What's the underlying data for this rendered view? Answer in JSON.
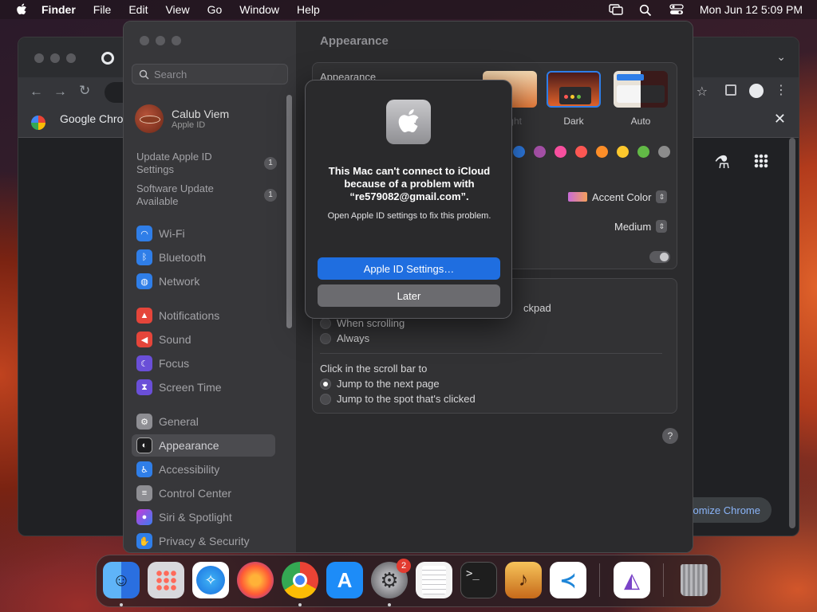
{
  "menubar": {
    "app_name": "Finder",
    "items": [
      "File",
      "Edit",
      "View",
      "Go",
      "Window",
      "Help"
    ],
    "clock": "Mon Jun 12  5:09 PM"
  },
  "chrome": {
    "tab_title": "Google Chrome",
    "customize_label": "Customize Chrome"
  },
  "settings": {
    "search_placeholder": "Search",
    "account": {
      "name": "Calub Viem",
      "subtitle": "Apple ID"
    },
    "notices": [
      {
        "label": "Update Apple ID Settings",
        "badge": "1"
      },
      {
        "label": "Software Update Available",
        "badge": "1"
      }
    ],
    "sidebar": [
      {
        "label": "Wi-Fi",
        "icon": "wifi-icon",
        "color": "#2f7ee8"
      },
      {
        "label": "Bluetooth",
        "icon": "bluetooth-icon",
        "color": "#2f7ee8"
      },
      {
        "label": "Network",
        "icon": "globe-icon",
        "color": "#2f7ee8"
      },
      {
        "label": "Notifications",
        "icon": "bell-icon",
        "color": "#e5453a"
      },
      {
        "label": "Sound",
        "icon": "speaker-icon",
        "color": "#e5453a"
      },
      {
        "label": "Focus",
        "icon": "moon-icon",
        "color": "#6a4fd8"
      },
      {
        "label": "Screen Time",
        "icon": "hourglass-icon",
        "color": "#6a4fd8"
      },
      {
        "label": "General",
        "icon": "gear-icon",
        "color": "#8e8e93"
      },
      {
        "label": "Appearance",
        "icon": "appearance-icon",
        "color": "#1c1c1e"
      },
      {
        "label": "Accessibility",
        "icon": "accessibility-icon",
        "color": "#2f7ee8"
      },
      {
        "label": "Control Center",
        "icon": "control-center-icon",
        "color": "#8e8e93"
      },
      {
        "label": "Siri & Spotlight",
        "icon": "siri-icon",
        "color": "#c83ad8"
      },
      {
        "label": "Privacy & Security",
        "icon": "hand-icon",
        "color": "#2f7ee8"
      }
    ],
    "selected": "Appearance",
    "content": {
      "title": "Appearance",
      "appearance_label": "Appearance",
      "themes": [
        "Light",
        "Dark",
        "Auto"
      ],
      "selected_theme": "Dark",
      "accent_colors": [
        "#2f7ee8",
        "#a550a7",
        "#f74f9e",
        "#fc5753",
        "#fd8e28",
        "#fdc82d",
        "#62ba46",
        "#8c8c8c"
      ],
      "highlight_popup": "Accent Color",
      "sidebar_size_popup": "Medium",
      "scroll_heading_fragment": "ckpad",
      "show_scroll_options": [
        "When scrolling",
        "Always"
      ],
      "click_scroll_label": "Click in the scroll bar to",
      "click_scroll_options": [
        "Jump to the next page",
        "Jump to the spot that's clicked"
      ],
      "click_scroll_selected": 0,
      "help": "?"
    }
  },
  "alert": {
    "title": "This Mac can't connect to iCloud because of a problem with “re579082@gmail.com”.",
    "message": "Open Apple ID settings to fix this problem.",
    "primary": "Apple ID Settings…",
    "secondary": "Later"
  },
  "dock": {
    "apps": [
      {
        "name": "finder-icon",
        "bg": "#3a8ff0"
      },
      {
        "name": "launchpad-icon",
        "bg": "#d8d8dc"
      },
      {
        "name": "safari-icon",
        "bg": "#ffffff"
      },
      {
        "name": "firefox-icon",
        "bg": "#5b2ab0"
      },
      {
        "name": "chrome-icon",
        "bg": "#ffffff"
      },
      {
        "name": "app-store-icon",
        "bg": "#1d8cf8"
      },
      {
        "name": "system-settings-icon",
        "bg": "#8e8e93",
        "badge": "2"
      },
      {
        "name": "textedit-icon",
        "bg": "#f4f4f4"
      },
      {
        "name": "terminal-icon",
        "bg": "#1e1e1e"
      },
      {
        "name": "garageband-icon",
        "bg": "#f2a33a"
      },
      {
        "name": "vscode-icon",
        "bg": "#ffffff"
      },
      {
        "name": "visual-studio-icon",
        "bg": "#ffffff"
      },
      {
        "name": "trash-icon",
        "bg": "#9a9a9e"
      }
    ]
  }
}
